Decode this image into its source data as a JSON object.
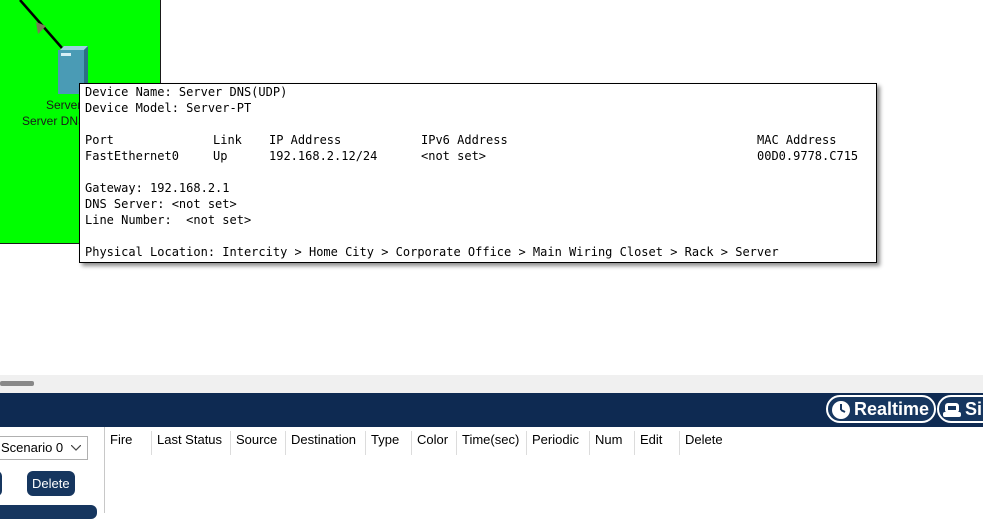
{
  "workspace": {
    "device": {
      "label_line1": "Server",
      "label_line2": "Server DNS",
      "icon": "server-icon"
    }
  },
  "tooltip": {
    "device_name": "Device Name: Server DNS(UDP)",
    "device_model": "Device Model: Server-PT",
    "headers": {
      "port": "Port",
      "link": "Link",
      "ip": "IP Address",
      "ipv6": "IPv6 Address",
      "mac": "MAC Address"
    },
    "row": {
      "port": "FastEthernet0",
      "link": "Up",
      "ip": "192.168.2.12/24",
      "ipv6": "<not set>",
      "mac": "00D0.9778.C715"
    },
    "gateway": "Gateway: 192.168.2.1",
    "dns_server": "DNS Server: <not set>",
    "line_number": "Line Number:  <not set>",
    "physical_location": "Physical Location: Intercity > Home City > Corporate Office > Main Wiring Closet > Rack > Server"
  },
  "toolbar": {
    "realtime_label": "Realtime",
    "simulation_label": "Si",
    "realtime_icon": "clock-icon",
    "simulation_icon": "simulation-icon"
  },
  "scenario": {
    "selected": "Scenario 0",
    "delete_label": "Delete"
  },
  "pdu_table": {
    "columns": [
      "Fire",
      "Last Status",
      "Source",
      "Destination",
      "Type",
      "Color",
      "Time(sec)",
      "Periodic",
      "Num",
      "Edit",
      "Delete"
    ]
  },
  "colors": {
    "workspace_green": "#00ff00",
    "bar_navy": "#0e2a52",
    "button_navy": "#16365f"
  }
}
